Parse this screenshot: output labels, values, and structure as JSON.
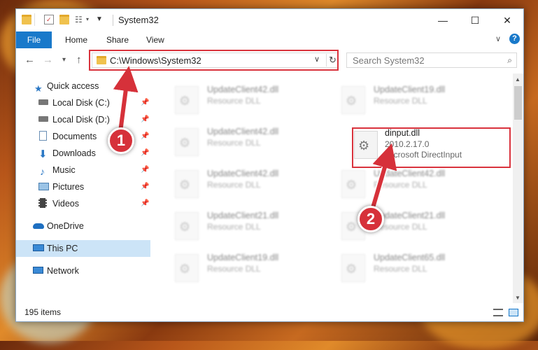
{
  "window": {
    "title": "System32",
    "controls": {
      "minimize": "—",
      "maximize": "☐",
      "close": "✕"
    }
  },
  "ribbon": {
    "file_tab": "File",
    "tabs": [
      "Home",
      "Share",
      "View"
    ]
  },
  "nav": {
    "address": "C:\\Windows\\System32",
    "search_placeholder": "Search System32"
  },
  "sidebar": {
    "items": [
      {
        "label": "Quick access",
        "icon": "star-icon",
        "pinned": false
      },
      {
        "label": "Local Disk (C:)",
        "icon": "drive-icon",
        "pinned": true
      },
      {
        "label": "Local Disk (D:)",
        "icon": "drive-icon",
        "pinned": true
      },
      {
        "label": "Documents",
        "icon": "documents-icon",
        "pinned": true
      },
      {
        "label": "Downloads",
        "icon": "download-icon",
        "pinned": true
      },
      {
        "label": "Music",
        "icon": "music-icon",
        "pinned": true
      },
      {
        "label": "Pictures",
        "icon": "pictures-icon",
        "pinned": true
      },
      {
        "label": "Videos",
        "icon": "video-icon",
        "pinned": true
      },
      {
        "label": "OneDrive",
        "icon": "cloud-icon",
        "pinned": false
      },
      {
        "label": "This PC",
        "icon": "computer-icon",
        "pinned": false,
        "selected": true
      },
      {
        "label": "Network",
        "icon": "network-icon",
        "pinned": false
      }
    ]
  },
  "files": [
    {
      "name": "UpdateClient42.dll",
      "type": "Resource DLL"
    },
    {
      "name": "UpdateClient19.dll",
      "type": "Resource DLL"
    },
    {
      "name": "UpdateClient42.dll",
      "type": "Resource DLL"
    },
    {
      "name": "dinput.dll",
      "type": "2010.2.17.0",
      "desc": "Microsoft DirectInput"
    },
    {
      "name": "UpdateClient42.dll",
      "type": "Resource DLL"
    },
    {
      "name": "UpdateClient42.dll",
      "type": "Resource DLL"
    },
    {
      "name": "UpdateClient21.dll",
      "type": "Resource DLL"
    },
    {
      "name": "UpdateClient21.dll",
      "type": "Resource DLL"
    },
    {
      "name": "UpdateClient19.dll",
      "type": "Resource DLL"
    },
    {
      "name": "UpdateClient65.dll",
      "type": "Resource DLL"
    }
  ],
  "status": {
    "count": "195 items"
  },
  "annotations": {
    "step1": "1",
    "step2": "2"
  },
  "colors": {
    "accent": "#1979ca",
    "highlight": "#d9333d",
    "selected": "#cce4f7"
  }
}
